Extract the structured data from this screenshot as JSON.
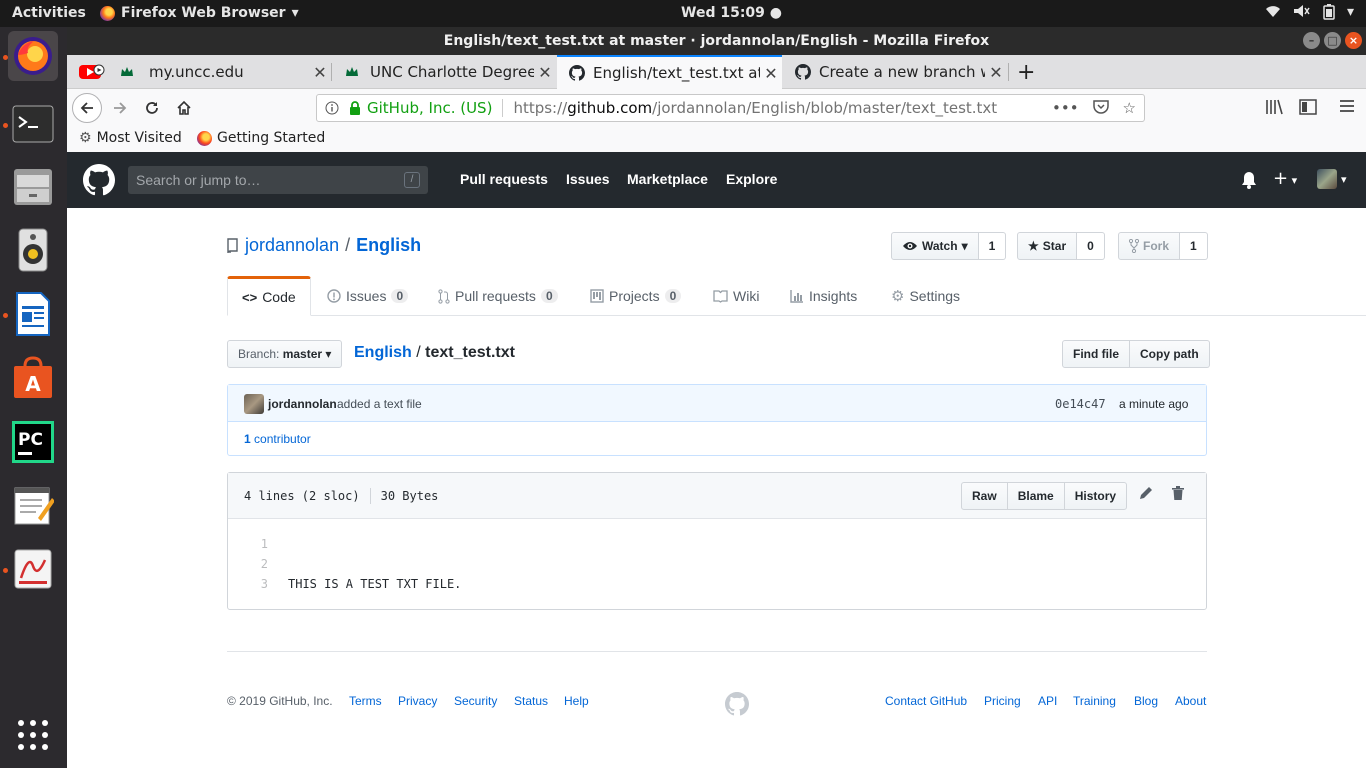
{
  "os": {
    "activities": "Activities",
    "app_menu": "Firefox Web Browser",
    "clock": "Wed 15:09"
  },
  "window": {
    "title": "English/text_test.txt at master · jordannolan/English - Mozilla Firefox"
  },
  "tabs": [
    {
      "label": "my.uncc.edu"
    },
    {
      "label": "UNC Charlotte DegreeWorks"
    },
    {
      "label": "English/text_test.txt at master"
    },
    {
      "label": "Create a new branch with git"
    }
  ],
  "urlbar": {
    "identity": "GitHub, Inc. (US)",
    "url_prefix": "https://",
    "url_host": "github.com",
    "url_path": "/jordannolan/English/blob/master/text_test.txt"
  },
  "bookmarks": [
    {
      "label": "Most Visited"
    },
    {
      "label": "Getting Started"
    }
  ],
  "gh_header": {
    "search_placeholder": "Search or jump to…",
    "search_hotkey": "/",
    "nav": [
      "Pull requests",
      "Issues",
      "Marketplace",
      "Explore"
    ]
  },
  "repo": {
    "owner": "jordannolan",
    "slash": "/",
    "name": "English",
    "watch_label": "Watch",
    "watch_count": "1",
    "star_label": "Star",
    "star_count": "0",
    "fork_label": "Fork",
    "fork_count": "1"
  },
  "repo_tabs": [
    {
      "label": "Code",
      "count": null
    },
    {
      "label": "Issues",
      "count": "0"
    },
    {
      "label": "Pull requests",
      "count": "0"
    },
    {
      "label": "Projects",
      "count": "0"
    },
    {
      "label": "Wiki",
      "count": null
    },
    {
      "label": "Insights",
      "count": null
    },
    {
      "label": "Settings",
      "count": null
    }
  ],
  "branch": {
    "prefix": "Branch:",
    "name": "master"
  },
  "breadcrumb": {
    "repo": "English",
    "sep": "/",
    "file": "text_test.txt"
  },
  "file_nav": {
    "find_file": "Find file",
    "copy_path": "Copy path"
  },
  "commit": {
    "author": "jordannolan",
    "message": "added a text file",
    "sha": "0e14c47",
    "time": "a minute ago",
    "contributors_count": "1",
    "contributors_label": "contributor"
  },
  "file": {
    "lines_info": "4 lines (2 sloc)",
    "size": "30 Bytes",
    "actions": [
      "Raw",
      "Blame",
      "History"
    ],
    "lines": [
      {
        "num": "1",
        "text": ""
      },
      {
        "num": "2",
        "text": ""
      },
      {
        "num": "3",
        "text": "THIS IS A TEST TXT FILE."
      }
    ]
  },
  "footer": {
    "copyright": "© 2019 GitHub, Inc.",
    "left_links": [
      "Terms",
      "Privacy",
      "Security",
      "Status",
      "Help"
    ],
    "right_links": [
      "Contact GitHub",
      "Pricing",
      "API",
      "Training",
      "Blog",
      "About"
    ]
  },
  "colors": {
    "github_header": "#24292e",
    "link_blue": "#0366d6",
    "selected_tab_accent": "#e36209",
    "ubuntu_orange": "#e95420"
  }
}
